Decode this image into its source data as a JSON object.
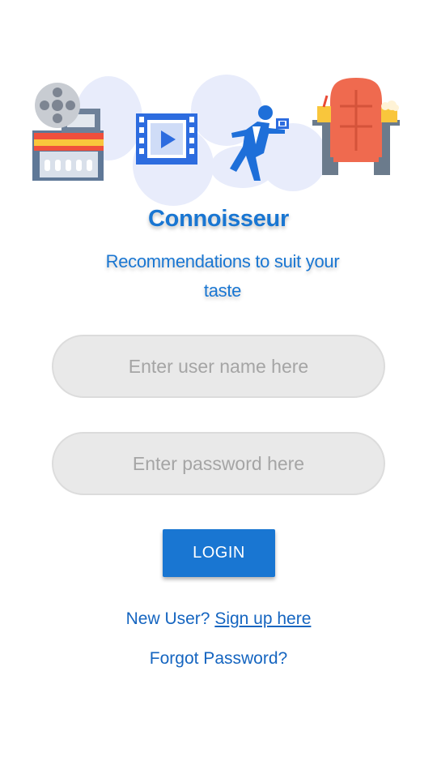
{
  "app": {
    "title": "Connoisseur",
    "tagline": "Recommendations to suit your taste"
  },
  "form": {
    "username_placeholder": "Enter user name here",
    "username_value": "",
    "password_placeholder": "Enter password here",
    "password_value": "",
    "login_label": "LOGIN"
  },
  "links": {
    "new_user_prefix": "New User?",
    "signup_label": "Sign up here",
    "forgot_label": "Forgot Password?"
  },
  "hero_icons": [
    "film-reel-cinema-icon",
    "video-film-strip-icon",
    "waiter-ticket-icon",
    "cinema-seat-icon"
  ],
  "colors": {
    "primary": "#1976d2",
    "link": "#1565c0",
    "field_bg": "#e9e9e9",
    "placeholder": "#a5a5a5",
    "hero_blob": "#e8ecfb"
  }
}
